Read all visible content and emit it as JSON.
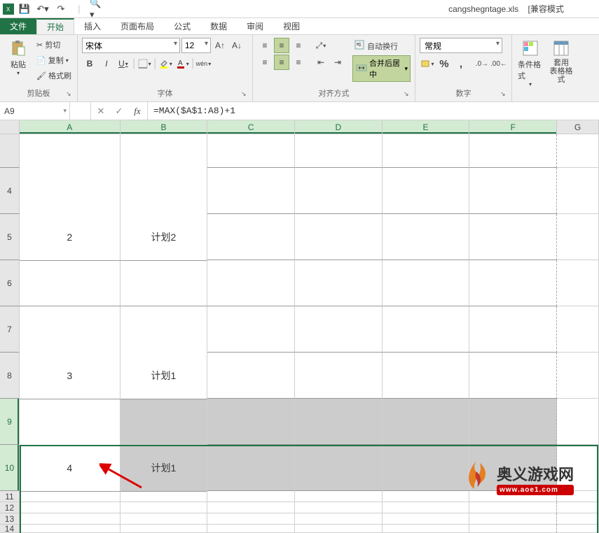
{
  "title": {
    "filename": "cangshegntage.xls",
    "mode": "[兼容模式"
  },
  "tabs": {
    "file": "文件",
    "home": "开始",
    "insert": "插入",
    "layout": "页面布局",
    "formulas": "公式",
    "data": "数据",
    "review": "审阅",
    "view": "视图"
  },
  "ribbon": {
    "clipboard": {
      "paste": "粘贴",
      "cut": "剪切",
      "copy": "复制",
      "painter": "格式刷",
      "label": "剪贴板"
    },
    "font": {
      "name": "宋体",
      "size": "12",
      "label": "字体",
      "bold": "B",
      "italic": "I",
      "underline": "U",
      "wen": "wén"
    },
    "alignment": {
      "wrap": "自动换行",
      "merge": "合并后居中",
      "label": "对齐方式"
    },
    "number": {
      "format": "常规",
      "percent": "%",
      "comma": ",",
      "label": "数字"
    },
    "styles": {
      "cond": "条件格式",
      "table": "套用\n表格格式"
    }
  },
  "formula_bar": {
    "name_box": "A9",
    "formula": "=MAX($A$1:A8)+1"
  },
  "columns": [
    "A",
    "B",
    "C",
    "D",
    "E",
    "F",
    "G"
  ],
  "rows_visible": [
    "4",
    "5",
    "6",
    "7",
    "8",
    "9",
    "10",
    "11",
    "12",
    "13",
    "14"
  ],
  "cells": {
    "A_merged45": "2",
    "B_merged45": "计划2",
    "A_merged78": "3",
    "B_merged78": "计划1",
    "A_merged910": "4",
    "B_merged910": "计划1"
  },
  "watermark": {
    "cn": "奥义游戏网",
    "en": "www.aoe1.com"
  }
}
